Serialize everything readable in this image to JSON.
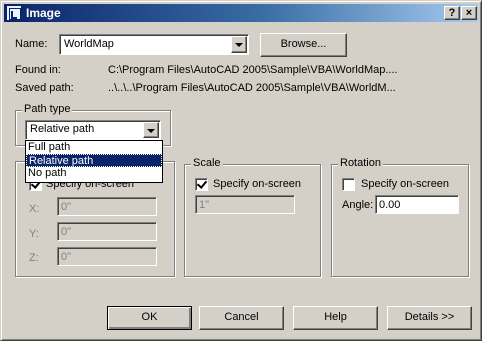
{
  "window": {
    "title": "Image"
  },
  "titlebar_buttons": {
    "help": "?",
    "close": "×"
  },
  "name_row": {
    "label": "Name:",
    "value": "WorldMap",
    "browse": "Browse..."
  },
  "found_in": {
    "label": "Found in:",
    "value": "C:\\Program Files\\AutoCAD 2005\\Sample\\VBA\\WorldMap...."
  },
  "saved_path": {
    "label": "Saved path:",
    "value": "..\\..\\..\\Program Files\\AutoCAD 2005\\Sample\\VBA\\WorldM..."
  },
  "path_type": {
    "label": "Path type",
    "selected": "Relative path",
    "options": [
      "Full path",
      "Relative path",
      "No path"
    ]
  },
  "insertion": {
    "specify": "Specify on-screen",
    "x_label": "X:",
    "x_value": "0\"",
    "y_label": "Y:",
    "y_value": "0\"",
    "z_label": "Z:",
    "z_value": "0\""
  },
  "scale": {
    "label": "Scale",
    "specify": "Specify on-screen",
    "value": "1\""
  },
  "rotation": {
    "label": "Rotation",
    "specify": "Specify on-screen",
    "angle_label": "Angle:",
    "angle_value": "0.00"
  },
  "buttons": {
    "ok": "OK",
    "cancel": "Cancel",
    "help": "Help",
    "details": "Details >>"
  }
}
